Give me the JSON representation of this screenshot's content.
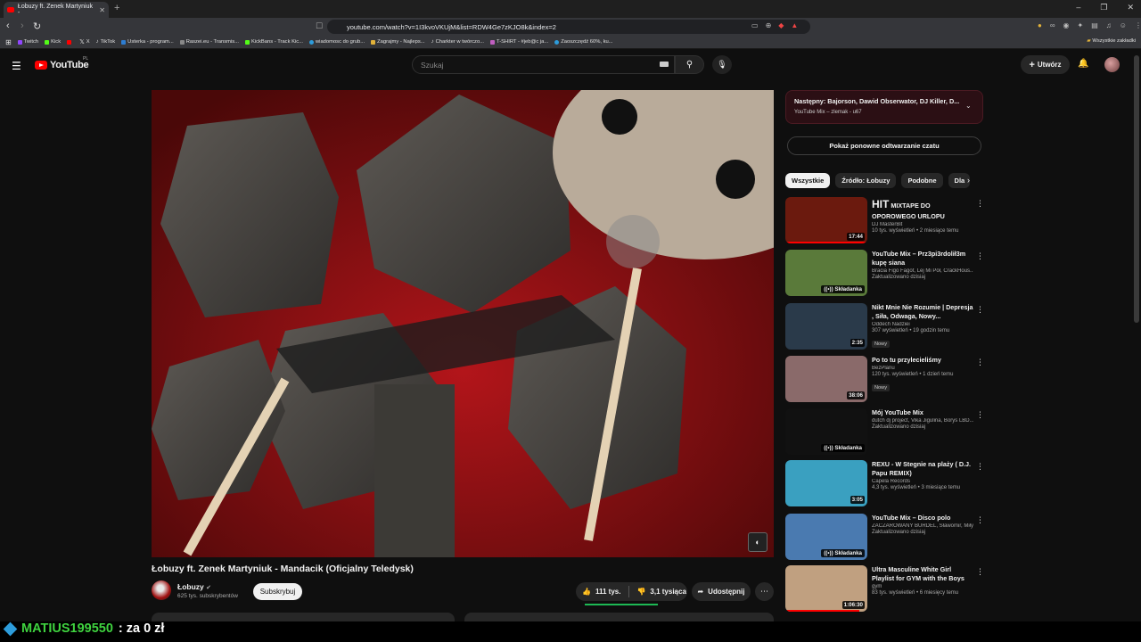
{
  "browser": {
    "tab_title": "Łobuzy ft. Zenek Martyniuk -",
    "new_tab": "+",
    "url": "youtube.com/watch?v=1I3kvoVKUjM&list=RDW4Ge7zKJO8k&index=2",
    "bookmarks": [
      {
        "label": "Twitch",
        "color": "#9146ff"
      },
      {
        "label": "Kick",
        "color": "#53fc18"
      },
      {
        "label": "",
        "color": "#ff0000"
      },
      {
        "label": "X",
        "color": "#000000"
      },
      {
        "label": "TikTok",
        "color": "#000000"
      },
      {
        "label": "Usterka - program...",
        "color": "#2d7dd2"
      },
      {
        "label": "Raszei.eu - Transmis...",
        "color": "#888888"
      },
      {
        "label": "KickBans - Track Kic...",
        "color": "#53fc18"
      },
      {
        "label": "wiadomosc do grub...",
        "color": "#2d9cdb"
      },
      {
        "label": "Zagrajmy - Najleps...",
        "color": "#e2b23a"
      },
      {
        "label": "Charkter w twórczo...",
        "color": "#000000"
      },
      {
        "label": "T-SHIRT - #jeb@c ja...",
        "color": "#c05ec0"
      },
      {
        "label": "Zaoszczędź 60%, ku...",
        "color": "#2d9cdb"
      }
    ],
    "bookmarks_right": "Wszystkie zakładki"
  },
  "header": {
    "logo_text": "YouTube",
    "region": "PL",
    "search_placeholder": "Szukaj",
    "create_label": "Utwórz"
  },
  "video": {
    "title": "Łobuzy ft. Zenek Martyniuk - Mandacik (Oficjalny Teledysk)",
    "channel": "Łobuzy",
    "subscribers": "625 tys. subskrybentów",
    "subscribe_label": "Subskrybuj",
    "likes": "111 tys.",
    "dislikes": "3,1 tysiąca",
    "share_label": "Udostępnij"
  },
  "sidebar": {
    "mix_title": "Następny: Bajorson, Dawid Obserwator, DJ Killer, D...",
    "mix_subtitle": "YouTube Mix – zlemak - u67",
    "chat_replay": "Pokaż ponowne odtwarzanie czatu",
    "chips": [
      "Wszystkie",
      "Źródło: Łobuzy",
      "Podobne",
      "Dla"
    ],
    "recommendations": [
      {
        "title": "MIXTAPE DO OPOROWEGO URLOPU",
        "title_prefix": "HIT",
        "channel": "DJ MasterBit",
        "meta": "10 tys. wyświetleń • 2 miesiące temu",
        "duration": "17:44",
        "badge": "",
        "new": "",
        "thumb_color": "#6b1a0e",
        "progress": 1.0
      },
      {
        "title": "YouTube Mix – Prz3pi3rdolił3m kupę siana",
        "channel": "Bracia Figo Fagot, Lej Mi Pół, CrackHous...",
        "meta": "Zaktualizowano dzisiaj",
        "duration": "",
        "badge": "Składanka",
        "new": "",
        "thumb_color": "#5a7a3a",
        "progress": 0
      },
      {
        "title": "Nikt Mnie Nie Rozumie | Depresja , Siła, Odwaga, Nowy...",
        "channel": "Oddech Nadziei",
        "meta": "307 wyświetleń • 19 godzin temu",
        "duration": "2:35",
        "badge": "",
        "new": "Nowy",
        "thumb_color": "#2a3a4a",
        "progress": 0
      },
      {
        "title": "Po to tu przylecieliśmy",
        "channel": "BezPlanu",
        "meta": "120 tys. wyświetleń • 1 dzień temu",
        "duration": "38:06",
        "badge": "",
        "new": "Nowy",
        "thumb_color": "#8a6a6a",
        "progress": 0
      },
      {
        "title": "Mój YouTube Mix",
        "channel": "dutch dj project, Vika Jigulina, Borys LBD...",
        "meta": "Zaktualizowano dzisiaj",
        "duration": "",
        "badge": "Składanka",
        "new": "",
        "thumb_color": "#111111",
        "progress": 0
      },
      {
        "title": "REXU - W Stegnie na plaży ( D.J. Papu REMIX)",
        "channel": "Capela Records",
        "meta": "4,3 tys. wyświetleń • 3 miesiące temu",
        "duration": "3:05",
        "badge": "",
        "new": "",
        "thumb_color": "#3aa0c0",
        "progress": 0
      },
      {
        "title": "YouTube Mix – Disco polo",
        "channel": "ZACZAROWANY BURDEL, Sławomir, Miły...",
        "meta": "Zaktualizowano dzisiaj",
        "duration": "",
        "badge": "Składanka",
        "new": "",
        "thumb_color": "#4a7ab0",
        "progress": 0
      },
      {
        "title": "Ultra Masculine White Girl Playlist for GYM with the Boys",
        "channel": "gym",
        "meta": "83 tys. wyświetleń • 6 miesięcy temu",
        "duration": "1:06:30",
        "badge": "",
        "new": "",
        "thumb_color": "#c0a080",
        "progress": 0.9
      }
    ]
  },
  "overlay": {
    "user": "MATIUS199550",
    "amount": ": za 0 zł"
  },
  "colors": {
    "accent": "#ff0000",
    "background": "#0f0f0f",
    "donation_user": "#3fd23f"
  }
}
